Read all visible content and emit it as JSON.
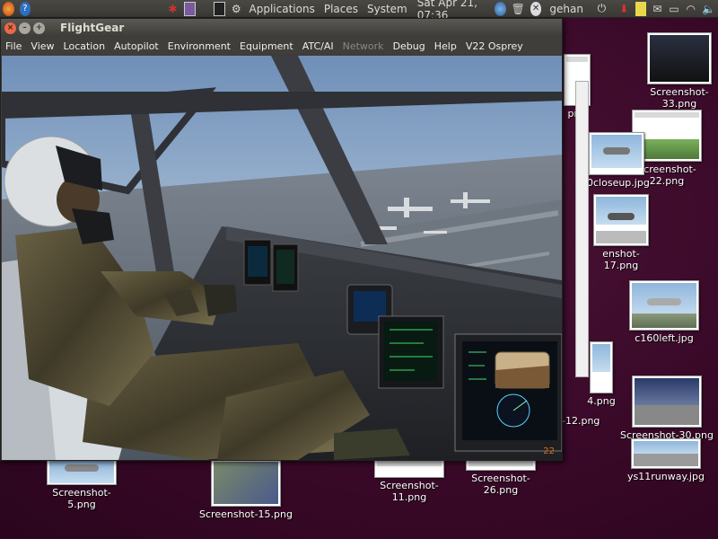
{
  "panel": {
    "menus": [
      "Applications",
      "Places",
      "System"
    ],
    "clock": "Sat Apr 21, 07:36",
    "user": "gehan"
  },
  "window": {
    "title": "FlightGear",
    "menus": [
      {
        "label": "File",
        "enabled": true
      },
      {
        "label": "View",
        "enabled": true
      },
      {
        "label": "Location",
        "enabled": true
      },
      {
        "label": "Autopilot",
        "enabled": true
      },
      {
        "label": "Environment",
        "enabled": true
      },
      {
        "label": "Equipment",
        "enabled": true
      },
      {
        "label": "ATC/AI",
        "enabled": true
      },
      {
        "label": "Network",
        "enabled": false
      },
      {
        "label": "Debug",
        "enabled": true
      },
      {
        "label": "Help",
        "enabled": true
      },
      {
        "label": "V22 Osprey",
        "enabled": true
      }
    ],
    "frame_rate": "22"
  },
  "desktop": {
    "icons": [
      {
        "label": "Screenshot-33.png"
      },
      {
        "label": "Screenshot-22.png"
      },
      {
        "label": "0closeup.jpg"
      },
      {
        "label": "enshot-17.png"
      },
      {
        "label": "c160left.jpg"
      },
      {
        "label": "4.png"
      },
      {
        "label": "-12.png"
      },
      {
        "label": "Screenshot-30.png"
      },
      {
        "label": "ys11runway.jpg"
      },
      {
        "label": "Screenshot-5.png"
      },
      {
        "label": "Screenshot-15.png"
      },
      {
        "label": "Screenshot-11.png"
      },
      {
        "label": "Screenshot-26.png"
      },
      {
        "label": "png"
      }
    ]
  }
}
